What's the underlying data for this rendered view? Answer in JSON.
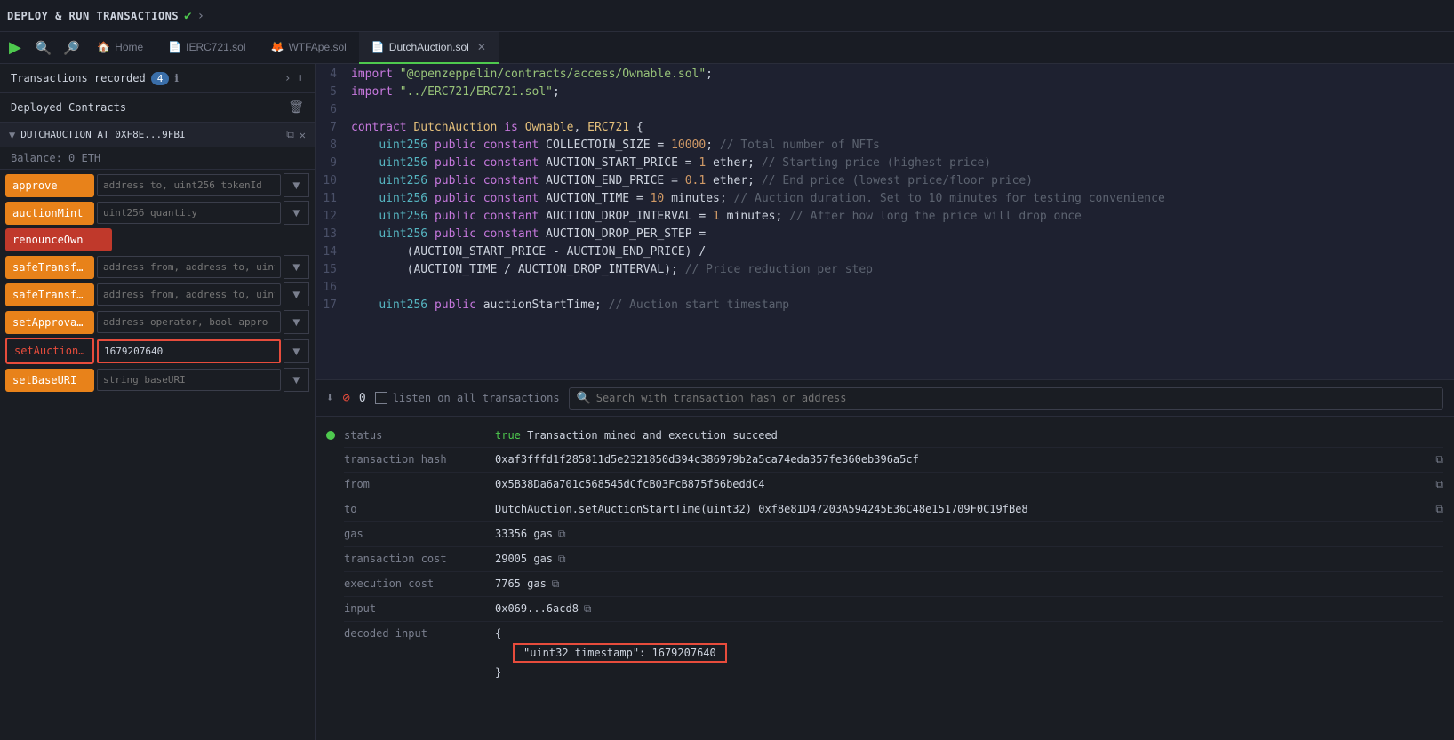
{
  "topbar": {
    "title": "DEPLOY & RUN TRANSACTIONS",
    "check": "✔",
    "arrow": "›"
  },
  "tabs": [
    {
      "id": "home",
      "icon": "🏠",
      "label": "Home",
      "active": false,
      "closeable": false
    },
    {
      "id": "ierc721",
      "icon": "📄",
      "label": "IERC721.sol",
      "active": false,
      "closeable": false
    },
    {
      "id": "wtfape",
      "icon": "🦊",
      "label": "WTFApe.sol",
      "active": false,
      "closeable": false
    },
    {
      "id": "dutchauction",
      "icon": "📄",
      "label": "DutchAuction.sol",
      "active": true,
      "closeable": true
    }
  ],
  "leftPanel": {
    "title": "Transactions recorded",
    "badge": "4",
    "deployedTitle": "Deployed Contracts",
    "contractName": "DUTCHAUCTION AT 0XF8E...9FBI",
    "balance": "Balance: 0 ETH",
    "functions": [
      {
        "id": "approve",
        "label": "approve",
        "style": "orange",
        "placeholder": "address to, uint256 tokenId",
        "hasDropdown": true
      },
      {
        "id": "auctionMint",
        "label": "auctionMint",
        "style": "orange",
        "placeholder": "uint256 quantity",
        "hasDropdown": true
      },
      {
        "id": "renounceOwn",
        "label": "renounceOwn",
        "style": "red",
        "placeholder": "",
        "hasDropdown": false
      },
      {
        "id": "safeTransferFr1",
        "label": "safeTransferFr",
        "style": "orange",
        "placeholder": "address from, address to, uint",
        "hasDropdown": true
      },
      {
        "id": "safeTransferFr2",
        "label": "safeTransferFr",
        "style": "orange",
        "placeholder": "address from, address to, uint",
        "hasDropdown": true
      },
      {
        "id": "setApprovalFo",
        "label": "setApprovalFo",
        "style": "orange",
        "placeholder": "address operator, bool appro",
        "hasDropdown": true
      },
      {
        "id": "setAuctionSta",
        "label": "setAuctionSta",
        "style": "active-outline",
        "placeholder": "1679207640",
        "hasDropdown": true,
        "active": true
      },
      {
        "id": "setBaseURI",
        "label": "setBaseURI",
        "style": "orange",
        "placeholder": "string baseURI",
        "hasDropdown": true
      }
    ]
  },
  "codeLines": [
    {
      "num": "4",
      "content": "import \"@openzeppelin/contracts/access/Ownable.sol\";"
    },
    {
      "num": "5",
      "content": "import \"../ERC721/ERC721.sol\";"
    },
    {
      "num": "6",
      "content": ""
    },
    {
      "num": "7",
      "content": "contract DutchAuction is Ownable, ERC721 {"
    },
    {
      "num": "8",
      "content": "    uint256 public constant COLLECTOIN_SIZE = 10000; // Total number of NFTs"
    },
    {
      "num": "9",
      "content": "    uint256 public constant AUCTION_START_PRICE = 1 ether; // Starting price (highest price)"
    },
    {
      "num": "10",
      "content": "    uint256 public constant AUCTION_END_PRICE = 0.1 ether; // End price (lowest price/floor price)"
    },
    {
      "num": "11",
      "content": "    uint256 public constant AUCTION_TIME = 10 minutes; // Auction duration. Set to 10 minutes for testing convenience"
    },
    {
      "num": "12",
      "content": "    uint256 public constant AUCTION_DROP_INTERVAL = 1 minutes; // After how long the price will drop once"
    },
    {
      "num": "13",
      "content": "    uint256 public constant AUCTION_DROP_PER_STEP ="
    },
    {
      "num": "14",
      "content": "        (AUCTION_START_PRICE - AUCTION_END_PRICE) /"
    },
    {
      "num": "15",
      "content": "        (AUCTION_TIME / AUCTION_DROP_INTERVAL); // Price reduction per step"
    },
    {
      "num": "16",
      "content": ""
    },
    {
      "num": "17",
      "content": "    uint256 public auctionStartTime; // Auction start timestamp"
    }
  ],
  "txBar": {
    "count": "0",
    "listenLabel": "listen on all transactions",
    "searchPlaceholder": "Search with transaction hash or address"
  },
  "transaction": {
    "status": {
      "label": "status",
      "value": "true Transaction mined and execution succeed"
    },
    "txHash": {
      "label": "transaction hash",
      "value": "0xaf3fffd1f285811d5e2321850d394c386979b2a5ca74eda357fe360eb396a5cf"
    },
    "from": {
      "label": "from",
      "value": "0x5B38Da6a701c568545dCfcB03FcB875f56beddC4"
    },
    "to": {
      "label": "to",
      "value": "DutchAuction.setAuctionStartTime(uint32) 0xf8e81D47203A594245E36C48e151709F0C19fBe8"
    },
    "gas": {
      "label": "gas",
      "value": "33356 gas"
    },
    "txCost": {
      "label": "transaction cost",
      "value": "29005 gas"
    },
    "execCost": {
      "label": "execution cost",
      "value": "7765 gas"
    },
    "input": {
      "label": "input",
      "value": "0x069...6acd8"
    },
    "decodedInput": {
      "label": "decoded input",
      "highlighted": "\"uint32 timestamp\": 1679207640"
    }
  }
}
